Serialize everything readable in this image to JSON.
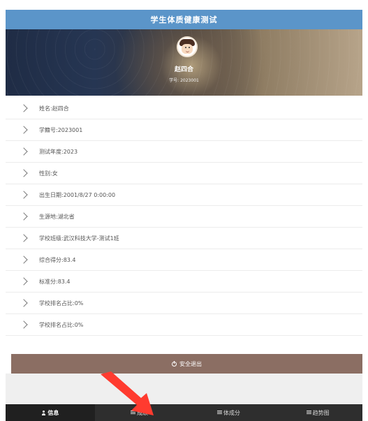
{
  "header": {
    "title": "学生体质健康测试"
  },
  "profile": {
    "name": "赵四合",
    "student_id_line": "学号: 2023001"
  },
  "info": {
    "items": [
      {
        "label": "姓名:赵四合"
      },
      {
        "label": "学籍号:2023001"
      },
      {
        "label": "测试年度:2023"
      },
      {
        "label": "性别:女"
      },
      {
        "label": "出生日期:2001/8/27 0:00:00"
      },
      {
        "label": "生源地:湖北省"
      },
      {
        "label": "学校班级:武汉科技大学-测试1班"
      },
      {
        "label": "综合得分:83.4"
      },
      {
        "label": "标准分:83.4"
      },
      {
        "label": "学校排名占比:0%"
      },
      {
        "label": "学校排名占比:0%"
      }
    ]
  },
  "actions": {
    "logout": "安全退出"
  },
  "bottom_nav": {
    "items": [
      {
        "label": "信息",
        "icon": "user-icon",
        "active": true
      },
      {
        "label": "成绩",
        "icon": "list-icon",
        "active": false
      },
      {
        "label": "体成分",
        "icon": "list-icon",
        "active": false
      },
      {
        "label": "趋势图",
        "icon": "list-icon",
        "active": false
      }
    ]
  },
  "colors": {
    "header": "#5b95c9",
    "logout": "#8b6e63",
    "nav": "#2e2e2e",
    "arrow": "#ff3b2f"
  }
}
